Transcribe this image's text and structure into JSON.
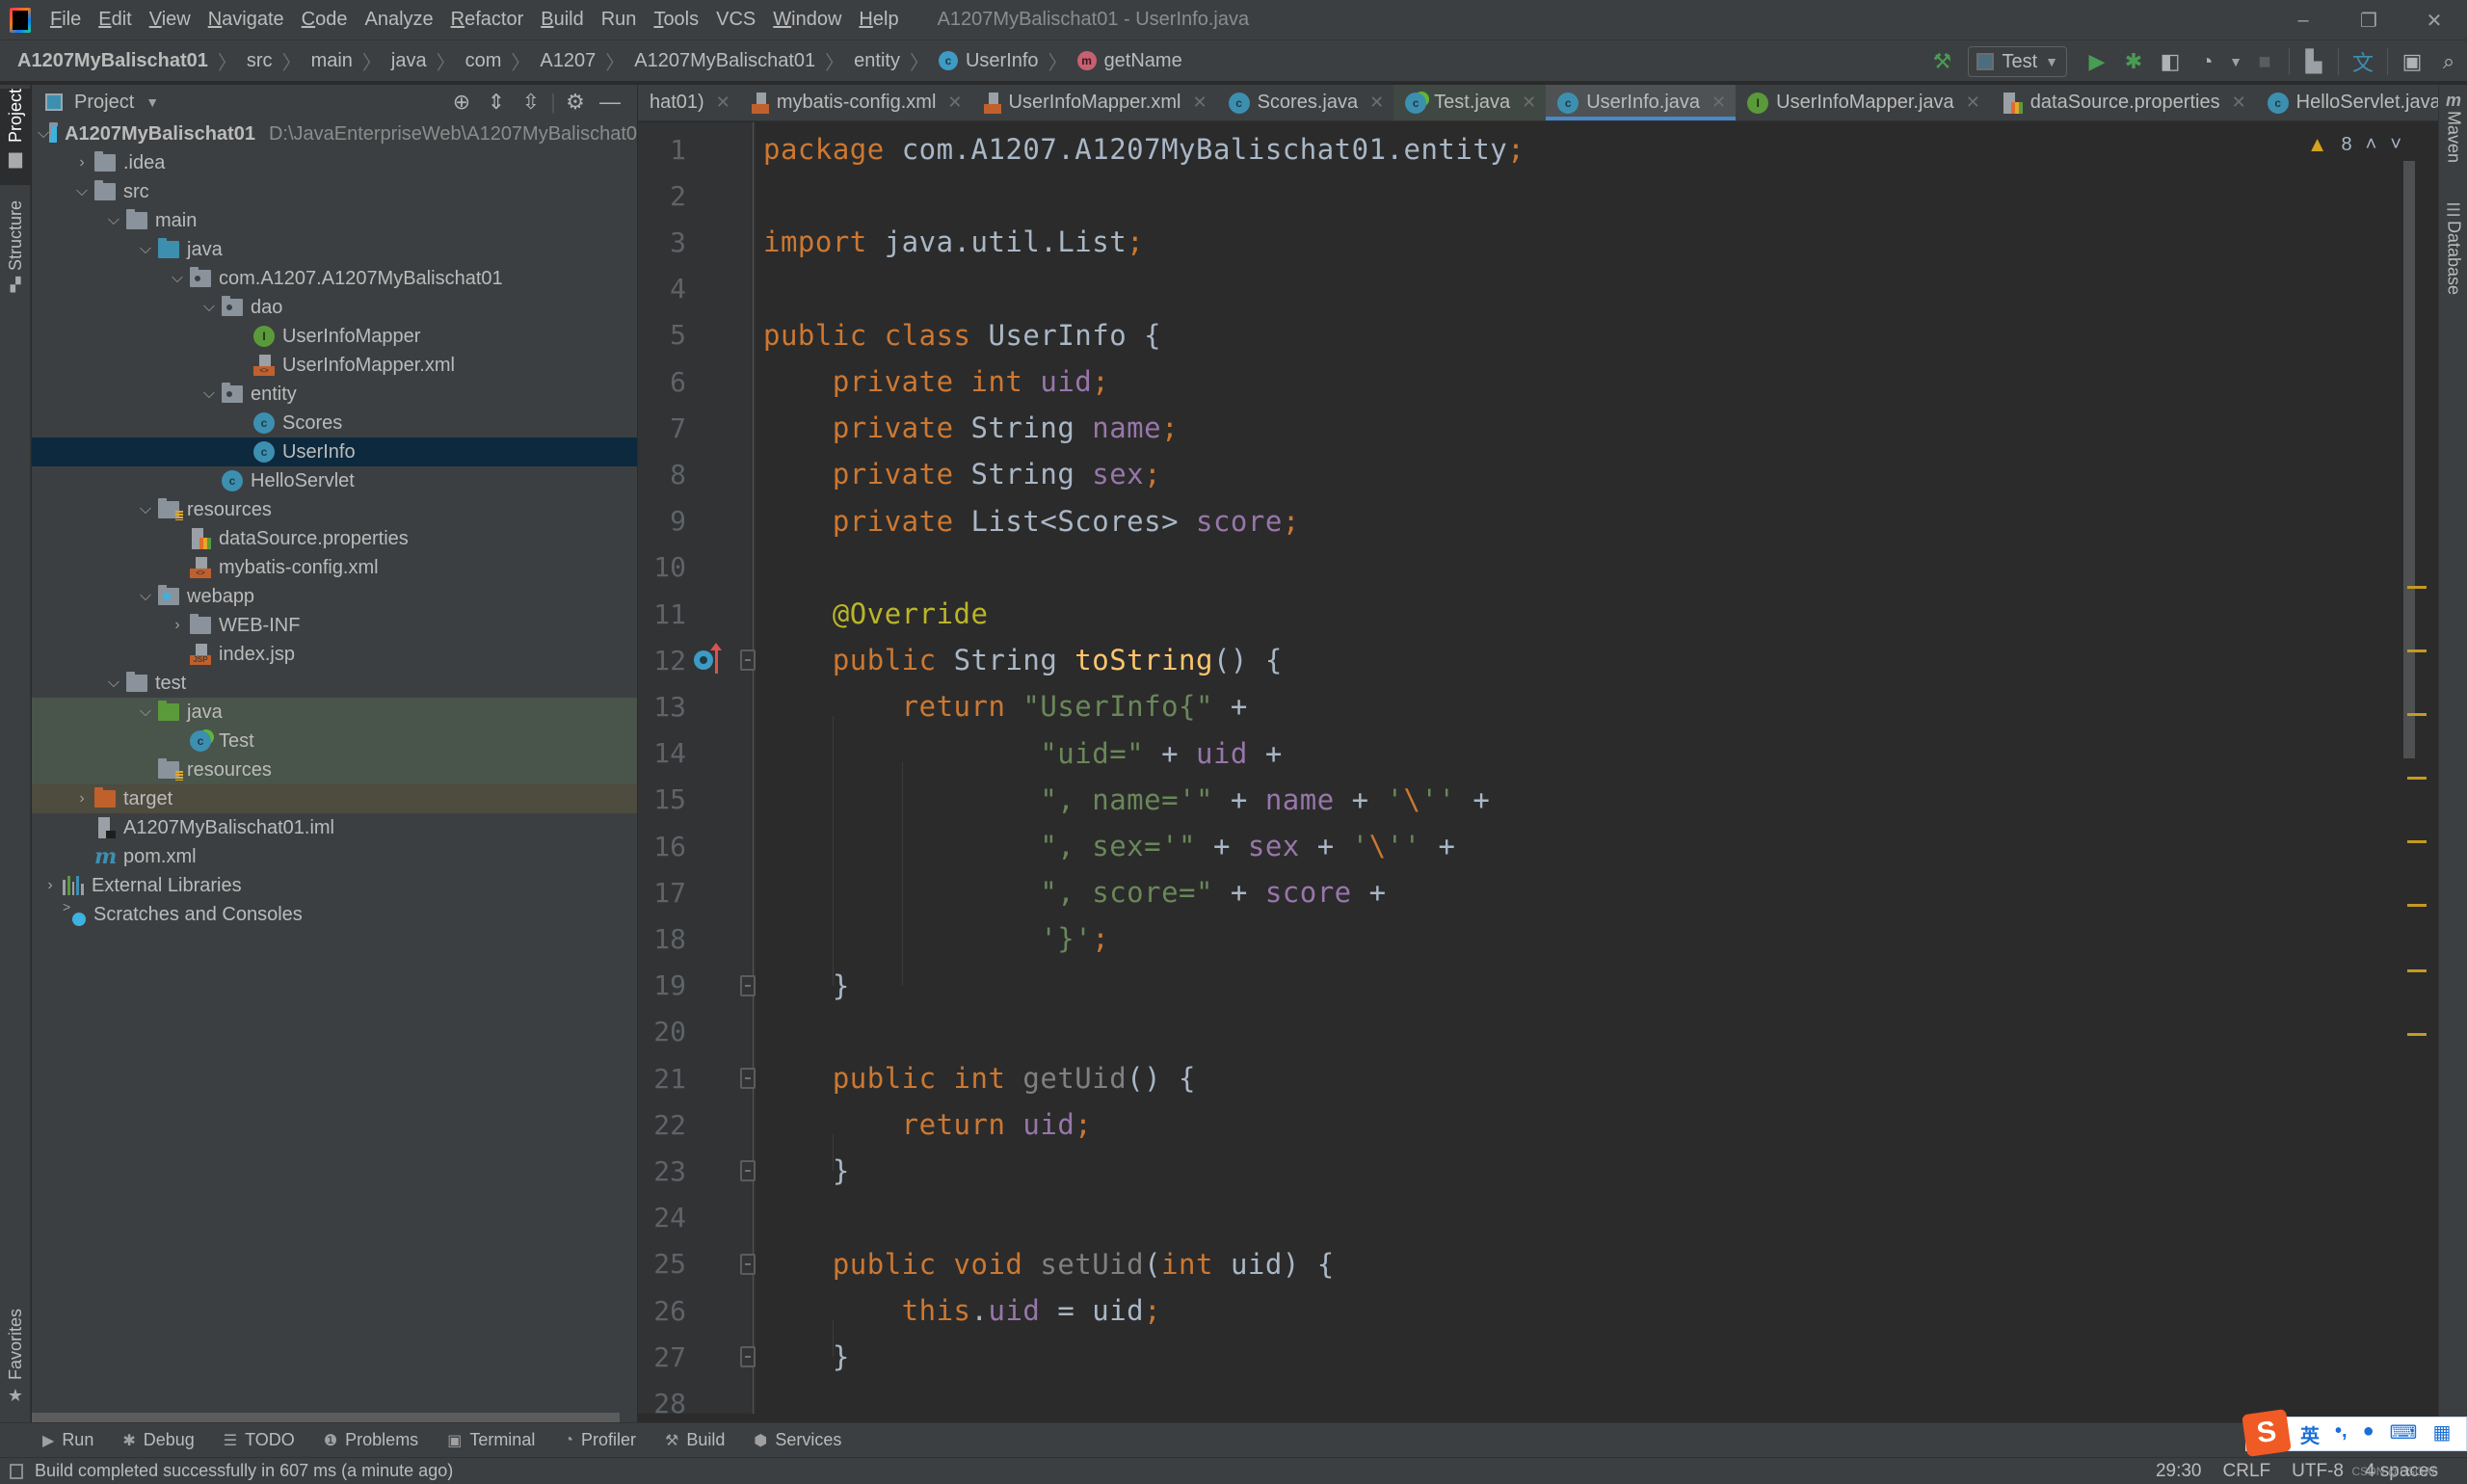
{
  "menubar": {
    "items": [
      {
        "label": "File",
        "mnemonic": "F",
        "rest": "ile"
      },
      {
        "label": "Edit",
        "mnemonic": "E",
        "rest": "dit"
      },
      {
        "label": "View",
        "mnemonic": "V",
        "rest": "iew"
      },
      {
        "label": "Navigate",
        "mnemonic": "N",
        "rest": "avigate"
      },
      {
        "label": "Code",
        "mnemonic": "C",
        "rest": "ode"
      },
      {
        "label": "Analyze",
        "mnemonic": "",
        "rest": "Analyze"
      },
      {
        "label": "Refactor",
        "mnemonic": "R",
        "rest": "efactor"
      },
      {
        "label": "Build",
        "mnemonic": "B",
        "rest": "uild"
      },
      {
        "label": "Run",
        "mnemonic": "",
        "rest": "Run"
      },
      {
        "label": "Tools",
        "mnemonic": "T",
        "rest": "ools"
      },
      {
        "label": "VCS",
        "mnemonic": "",
        "rest": "VCS"
      },
      {
        "label": "Window",
        "mnemonic": "W",
        "rest": "indow"
      },
      {
        "label": "Help",
        "mnemonic": "H",
        "rest": "elp"
      }
    ],
    "window_title": "A1207MyBalischat01 - UserInfo.java",
    "controls": {
      "minimize": "–",
      "restore": "❐",
      "close": "✕"
    }
  },
  "navbar": {
    "breadcrumbs": [
      "A1207MyBalischat01",
      "src",
      "main",
      "java",
      "com",
      "A1207",
      "A1207MyBalischat01",
      "entity",
      "UserInfo",
      "getName"
    ],
    "class_badge": "c",
    "method_badge": "m",
    "run_config": "Test"
  },
  "left_stripe": {
    "project": "Project",
    "structure": "Structure",
    "favorites": "Favorites"
  },
  "right_stripe": {
    "maven": "Maven",
    "database": "Database"
  },
  "project_panel": {
    "title": "Project",
    "tree": [
      {
        "label": "A1207MyBalischat01",
        "hint": "D:\\JavaEnterpriseWeb\\A1207MyBalischat0",
        "depth": 0,
        "arrow": "down",
        "icon": "module",
        "bold": true
      },
      {
        "label": ".idea",
        "depth": 1,
        "arrow": "right",
        "icon": "folder"
      },
      {
        "label": "src",
        "depth": 1,
        "arrow": "down",
        "icon": "folder"
      },
      {
        "label": "main",
        "depth": 2,
        "arrow": "down",
        "icon": "folder"
      },
      {
        "label": "java",
        "depth": 3,
        "arrow": "down",
        "icon": "folder-blue"
      },
      {
        "label": "com.A1207.A1207MyBalischat01",
        "depth": 4,
        "arrow": "down",
        "icon": "package"
      },
      {
        "label": "dao",
        "depth": 5,
        "arrow": "down",
        "icon": "package"
      },
      {
        "label": "UserInfoMapper",
        "depth": 6,
        "arrow": "none",
        "icon": "interface"
      },
      {
        "label": "UserInfoMapper.xml",
        "depth": 6,
        "arrow": "none",
        "icon": "xml"
      },
      {
        "label": "entity",
        "depth": 5,
        "arrow": "down",
        "icon": "package"
      },
      {
        "label": "Scores",
        "depth": 6,
        "arrow": "none",
        "icon": "class"
      },
      {
        "label": "UserInfo",
        "depth": 6,
        "arrow": "none",
        "icon": "class",
        "selected": true
      },
      {
        "label": "HelloServlet",
        "depth": 5,
        "arrow": "none",
        "icon": "class"
      },
      {
        "label": "resources",
        "depth": 3,
        "arrow": "down",
        "icon": "resources"
      },
      {
        "label": "dataSource.properties",
        "depth": 4,
        "arrow": "none",
        "icon": "properties"
      },
      {
        "label": "mybatis-config.xml",
        "depth": 4,
        "arrow": "none",
        "icon": "xml"
      },
      {
        "label": "webapp",
        "depth": 3,
        "arrow": "down",
        "icon": "web"
      },
      {
        "label": "WEB-INF",
        "depth": 4,
        "arrow": "right",
        "icon": "folder"
      },
      {
        "label": "index.jsp",
        "depth": 4,
        "arrow": "none",
        "icon": "jsp"
      },
      {
        "label": "test",
        "depth": 2,
        "arrow": "down",
        "icon": "folder"
      },
      {
        "label": "java",
        "depth": 3,
        "arrow": "down",
        "icon": "folder-green",
        "bg": "test"
      },
      {
        "label": "Test",
        "depth": 4,
        "arrow": "none",
        "icon": "test-class",
        "bg": "test"
      },
      {
        "label": "resources",
        "depth": 3,
        "arrow": "none",
        "icon": "test-resources",
        "bg": "test"
      },
      {
        "label": "target",
        "depth": 1,
        "arrow": "right",
        "icon": "folder-orange",
        "bg": "excluded"
      },
      {
        "label": "A1207MyBalischat01.iml",
        "depth": 1,
        "arrow": "none",
        "icon": "iml"
      },
      {
        "label": "pom.xml",
        "depth": 1,
        "arrow": "none",
        "icon": "maven"
      },
      {
        "label": "External Libraries",
        "depth": 0,
        "arrow": "right",
        "icon": "libraries"
      },
      {
        "label": "Scratches and Consoles",
        "depth": 0,
        "arrow": "none",
        "icon": "scratches"
      }
    ]
  },
  "editor_tabs": [
    {
      "label": "hat01)",
      "icon": "none",
      "truncated": true
    },
    {
      "label": "mybatis-config.xml",
      "icon": "xml"
    },
    {
      "label": "UserInfoMapper.xml",
      "icon": "xml"
    },
    {
      "label": "Scores.java",
      "icon": "class"
    },
    {
      "label": "Test.java",
      "icon": "test-class"
    },
    {
      "label": "UserInfo.java",
      "icon": "class",
      "active": true
    },
    {
      "label": "UserInfoMapper.java",
      "icon": "interface"
    },
    {
      "label": "dataSource.properties",
      "icon": "properties"
    },
    {
      "label": "HelloServlet.java",
      "icon": "class"
    }
  ],
  "editor": {
    "inspection_warnings": "8",
    "lines": [
      {
        "n": "1",
        "tokens": [
          [
            "kw",
            "package "
          ],
          [
            "",
            "com.A1207.A1207MyBalischat01.entity"
          ],
          [
            "semi",
            ";"
          ]
        ]
      },
      {
        "n": "2",
        "tokens": []
      },
      {
        "n": "3",
        "tokens": [
          [
            "kw",
            "import "
          ],
          [
            "",
            "java.util.List"
          ],
          [
            "semi",
            ";"
          ]
        ]
      },
      {
        "n": "4",
        "tokens": []
      },
      {
        "n": "5",
        "tokens": [
          [
            "kw",
            "public class "
          ],
          [
            "",
            "UserInfo {"
          ]
        ]
      },
      {
        "n": "6",
        "tokens": [
          [
            "kw",
            "    private int "
          ],
          [
            "fld",
            "uid"
          ],
          [
            "semi",
            ";"
          ]
        ]
      },
      {
        "n": "7",
        "tokens": [
          [
            "kw",
            "    private "
          ],
          [
            "",
            "String "
          ],
          [
            "fld",
            "name"
          ],
          [
            "semi",
            ";"
          ]
        ]
      },
      {
        "n": "8",
        "tokens": [
          [
            "kw",
            "    private "
          ],
          [
            "",
            "String "
          ],
          [
            "fld",
            "sex"
          ],
          [
            "semi",
            ";"
          ]
        ]
      },
      {
        "n": "9",
        "tokens": [
          [
            "kw",
            "    private "
          ],
          [
            "",
            "List<Scores> "
          ],
          [
            "fld",
            "score"
          ],
          [
            "semi",
            ";"
          ]
        ]
      },
      {
        "n": "10",
        "tokens": []
      },
      {
        "n": "11",
        "tokens": [
          [
            "ann",
            "    @Override"
          ]
        ]
      },
      {
        "n": "12",
        "tokens": [
          [
            "kw",
            "    public "
          ],
          [
            "",
            "String "
          ],
          [
            "mth",
            "toString"
          ],
          [
            "",
            "() {"
          ]
        ]
      },
      {
        "n": "13",
        "tokens": [
          [
            "kw",
            "        return "
          ],
          [
            "str",
            "\"UserInfo{\""
          ],
          [
            "",
            " +"
          ]
        ]
      },
      {
        "n": "14",
        "tokens": [
          [
            "str",
            "                \"uid=\""
          ],
          [
            "",
            " + "
          ],
          [
            "fld",
            "uid"
          ],
          [
            "",
            " +"
          ]
        ]
      },
      {
        "n": "15",
        "tokens": [
          [
            "str",
            "                \", name='\""
          ],
          [
            "",
            " + "
          ],
          [
            "fld",
            "name"
          ],
          [
            "",
            " + "
          ],
          [
            "str",
            "'"
          ],
          [
            "kw",
            "\\"
          ],
          [
            "str",
            "''"
          ],
          [
            "",
            " +"
          ]
        ]
      },
      {
        "n": "16",
        "tokens": [
          [
            "str",
            "                \", sex='\""
          ],
          [
            "",
            " + "
          ],
          [
            "fld",
            "sex"
          ],
          [
            "",
            " + "
          ],
          [
            "str",
            "'"
          ],
          [
            "kw",
            "\\"
          ],
          [
            "str",
            "''"
          ],
          [
            "",
            " +"
          ]
        ]
      },
      {
        "n": "17",
        "tokens": [
          [
            "str",
            "                \", score=\""
          ],
          [
            "",
            " + "
          ],
          [
            "fld",
            "score"
          ],
          [
            "",
            " +"
          ]
        ]
      },
      {
        "n": "18",
        "tokens": [
          [
            "str",
            "                '}'"
          ],
          [
            "semi",
            ";"
          ]
        ]
      },
      {
        "n": "19",
        "tokens": [
          [
            "",
            "    }"
          ]
        ]
      },
      {
        "n": "20",
        "tokens": []
      },
      {
        "n": "21",
        "tokens": [
          [
            "kw",
            "    public int "
          ],
          [
            "unused",
            "getUid"
          ],
          [
            "",
            "() {"
          ]
        ]
      },
      {
        "n": "22",
        "tokens": [
          [
            "kw",
            "        return "
          ],
          [
            "fld",
            "uid"
          ],
          [
            "semi",
            ";"
          ]
        ]
      },
      {
        "n": "23",
        "tokens": [
          [
            "",
            "    }"
          ]
        ]
      },
      {
        "n": "24",
        "tokens": []
      },
      {
        "n": "25",
        "tokens": [
          [
            "kw",
            "    public void "
          ],
          [
            "unused",
            "setUid"
          ],
          [
            "",
            "("
          ],
          [
            "kw",
            "int "
          ],
          [
            "",
            "uid) {"
          ]
        ]
      },
      {
        "n": "26",
        "tokens": [
          [
            "kw",
            "        this"
          ],
          [
            "",
            "."
          ],
          [
            "fld",
            "uid"
          ],
          [
            "",
            " = uid"
          ],
          [
            "semi",
            ";"
          ]
        ]
      },
      {
        "n": "27",
        "tokens": [
          [
            "",
            "    }"
          ]
        ]
      },
      {
        "n": "28",
        "tokens": []
      }
    ]
  },
  "bottom_tools": [
    {
      "label": "Run",
      "icon": "run-icon",
      "glyph": "▶"
    },
    {
      "label": "Debug",
      "icon": "debug-icon",
      "glyph": "✱"
    },
    {
      "label": "TODO",
      "icon": "todo-icon",
      "glyph": "☰"
    },
    {
      "label": "Problems",
      "icon": "problems-icon",
      "glyph": "❶"
    },
    {
      "label": "Terminal",
      "icon": "terminal-icon",
      "glyph": "▣"
    },
    {
      "label": "Profiler",
      "icon": "profiler-icon",
      "glyph": "◔"
    },
    {
      "label": "Build",
      "icon": "build-icon",
      "glyph": "⚒"
    },
    {
      "label": "Services",
      "icon": "services-icon",
      "glyph": "⬢"
    }
  ],
  "status_bar": {
    "message": "Build completed successfully in 607 ms (a minute ago)",
    "position": "29:30",
    "line_separator": "CRLF",
    "encoding": "UTF-8",
    "indent": "4 spaces"
  },
  "ime": {
    "logo": "S",
    "lang": "英",
    "punct": "•,",
    "mic": "🎤",
    "keyboard": "⌨",
    "menu": "▦"
  },
  "watermark": "CSDN @SSOA6",
  "colors": {
    "keyword": "#cc7832",
    "field": "#9876aa",
    "string": "#6a8759",
    "annotation": "#bbb529",
    "method": "#ffc66d",
    "default_text": "#a9b7c6",
    "selection": "#0d293e",
    "active_tab_underline": "#4a88c7",
    "warning": "#d6a321"
  }
}
